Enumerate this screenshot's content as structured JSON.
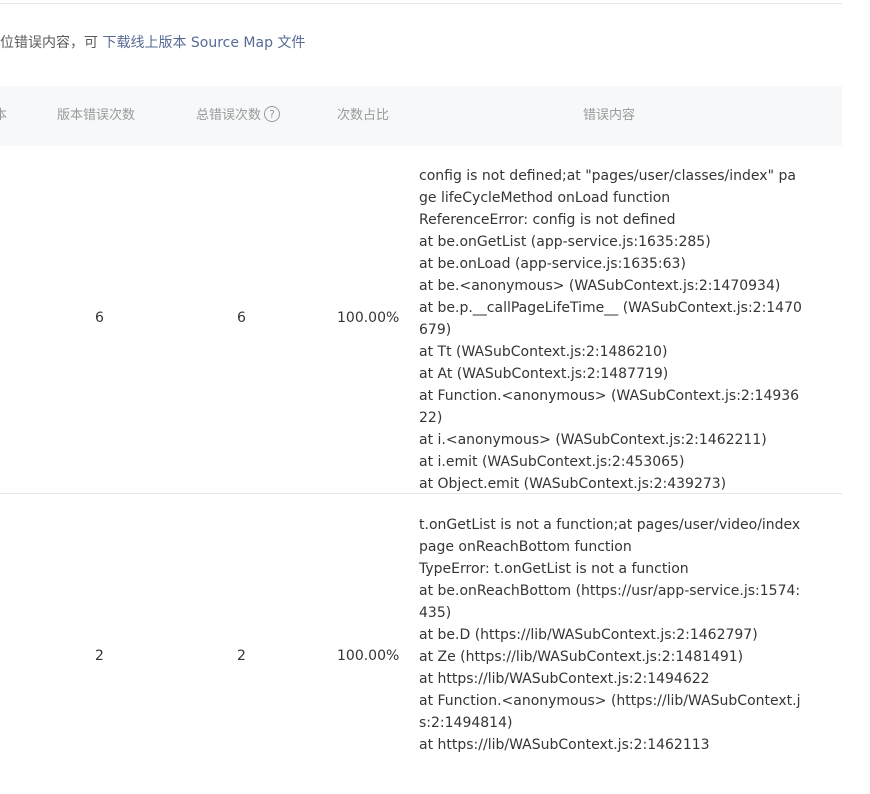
{
  "hint": {
    "prefix": "定位错误内容，可",
    "link": "下载线上版本 Source Map 文件"
  },
  "table": {
    "columns": [
      "本",
      "版本错误次数",
      "总错误次数",
      "次数占比",
      "错误内容"
    ],
    "rows": [
      {
        "version_errors": "6",
        "total_errors": "6",
        "ratio": "100.00%",
        "lines": [
          "config is not defined;at \"pages/user/classes/index\" page lifeCycleMethod onLoad function",
          "ReferenceError: config is not defined",
          "at be.onGetList (app-service.js:1635:285)",
          "at be.onLoad (app-service.js:1635:63)",
          "at be.<anonymous> (WASubContext.js:2:1470934)",
          "at be.p.__callPageLifeTime__ (WASubContext.js:2:1470679)",
          "at Tt (WASubContext.js:2:1486210)",
          "at At (WASubContext.js:2:1487719)",
          "at Function.<anonymous> (WASubContext.js:2:1493622)",
          "at i.<anonymous> (WASubContext.js:2:1462211)",
          "at i.emit (WASubContext.js:2:453065)",
          "at Object.emit (WASubContext.js:2:439273)"
        ]
      },
      {
        "version_errors": "2",
        "total_errors": "2",
        "ratio": "100.00%",
        "lines": [
          "t.onGetList is not a function;at pages/user/video/index page onReachBottom function",
          "TypeError: t.onGetList is not a function",
          "at be.onReachBottom (https://usr/app-service.js:1574:435)",
          "at be.D (https://lib/WASubContext.js:2:1462797)",
          "at Ze (https://lib/WASubContext.js:2:1481491)",
          "at https://lib/WASubContext.js:2:1494622",
          "at Function.<anonymous> (https://lib/WASubContext.js:2:1494814)",
          "at https://lib/WASubContext.js:2:1462113"
        ]
      }
    ]
  },
  "icons": {
    "help": "question-circle-icon"
  },
  "colors": {
    "link": "#576b95",
    "header_bg": "#f6f8f9",
    "muted": "#9a9a9a"
  }
}
